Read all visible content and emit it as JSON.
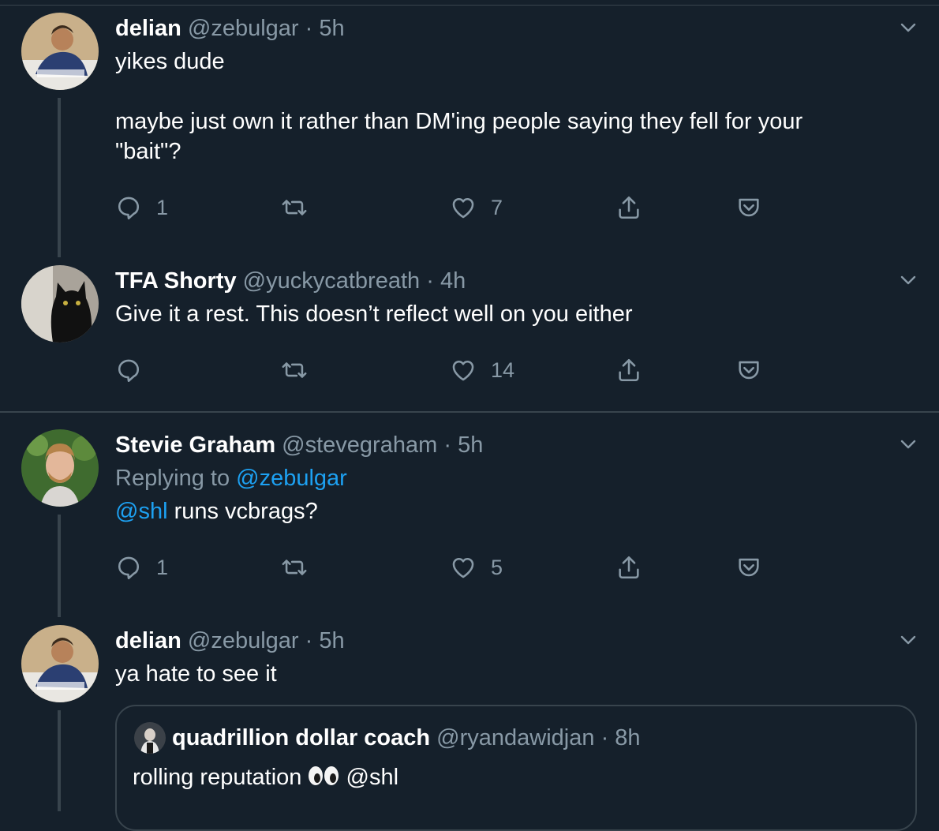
{
  "colors": {
    "background": "#15202b",
    "border": "#38444d",
    "muted": "#8899a6",
    "link": "#1da1f2",
    "text": "#ffffff"
  },
  "tweets": [
    {
      "name": "delian",
      "handle": "@zebulgar",
      "dot": "·",
      "time": "5h",
      "line1": "yikes dude",
      "line2": "maybe just own it rather than DM'ing people saying they fell for your",
      "line3": "\"bait\"?",
      "reply_count": "1",
      "like_count": "7",
      "avatar_icon": "person-avatar"
    },
    {
      "name": "TFA Shorty",
      "handle": "@yuckycatbreath",
      "dot": "·",
      "time": "4h",
      "text": "Give it a rest. This doesn’t reflect well on you either",
      "reply_count": "",
      "like_count": "14",
      "avatar_icon": "black-cat-avatar"
    },
    {
      "name": "Stevie Graham",
      "handle": "@stevegraham",
      "dot": "·",
      "time": "5h",
      "replying_prefix": "Replying to ",
      "replying_to": "@zebulgar",
      "mention": "@shl",
      "text_rest": " runs vcbrags?",
      "reply_count": "1",
      "like_count": "5",
      "avatar_icon": "person-avatar"
    },
    {
      "name": "delian",
      "handle": "@zebulgar",
      "dot": "·",
      "time": "5h",
      "text": "ya hate to see it",
      "avatar_icon": "person-avatar",
      "quote": {
        "name": "quadrillion dollar coach",
        "handle": "@ryandawidjan",
        "dot": "·",
        "time": "8h",
        "text_before": "rolling reputation ",
        "emoji": "eyes",
        "text_after": " @shl"
      }
    }
  ],
  "icons": {
    "reply": "reply-icon",
    "retweet": "retweet-icon",
    "like": "heart-icon",
    "share": "share-icon",
    "save": "pocket-icon",
    "menu": "chevron-down-icon"
  }
}
